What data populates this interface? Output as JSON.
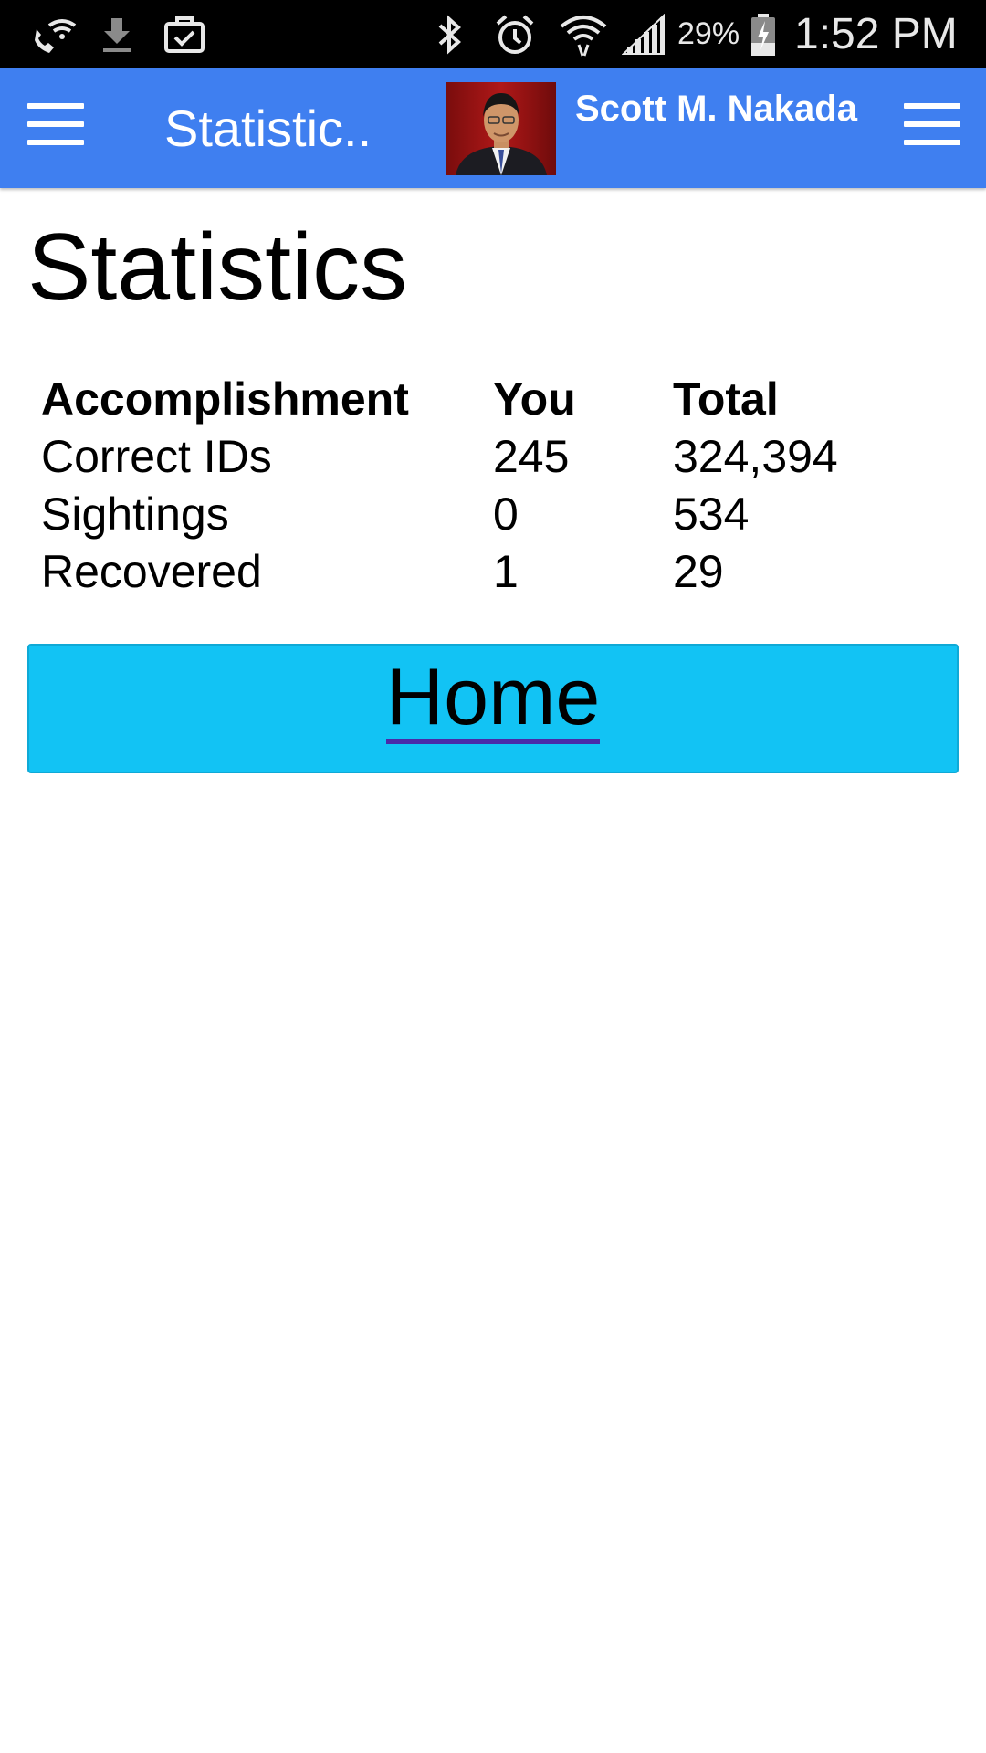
{
  "status_bar": {
    "battery_percent": "29%",
    "time": "1:52 PM",
    "icons": [
      "wifi-call-icon",
      "download-icon",
      "briefcase-check-icon",
      "bluetooth-icon",
      "alarm-icon",
      "wifi-icon",
      "signal-icon",
      "battery-charging-icon"
    ]
  },
  "app_bar": {
    "title": "Statistic..",
    "user_name": "Scott M. Nakada",
    "color": "#3f7ff0"
  },
  "page": {
    "title": "Statistics"
  },
  "stats": {
    "headers": [
      "Accomplishment",
      "You",
      "Total"
    ],
    "rows": [
      [
        "Correct IDs",
        "245",
        "324,394"
      ],
      [
        "Sightings",
        "0",
        "534"
      ],
      [
        "Recovered",
        "1",
        "29"
      ]
    ]
  },
  "home_button": {
    "label": "Home",
    "color": "#12c3f4"
  }
}
